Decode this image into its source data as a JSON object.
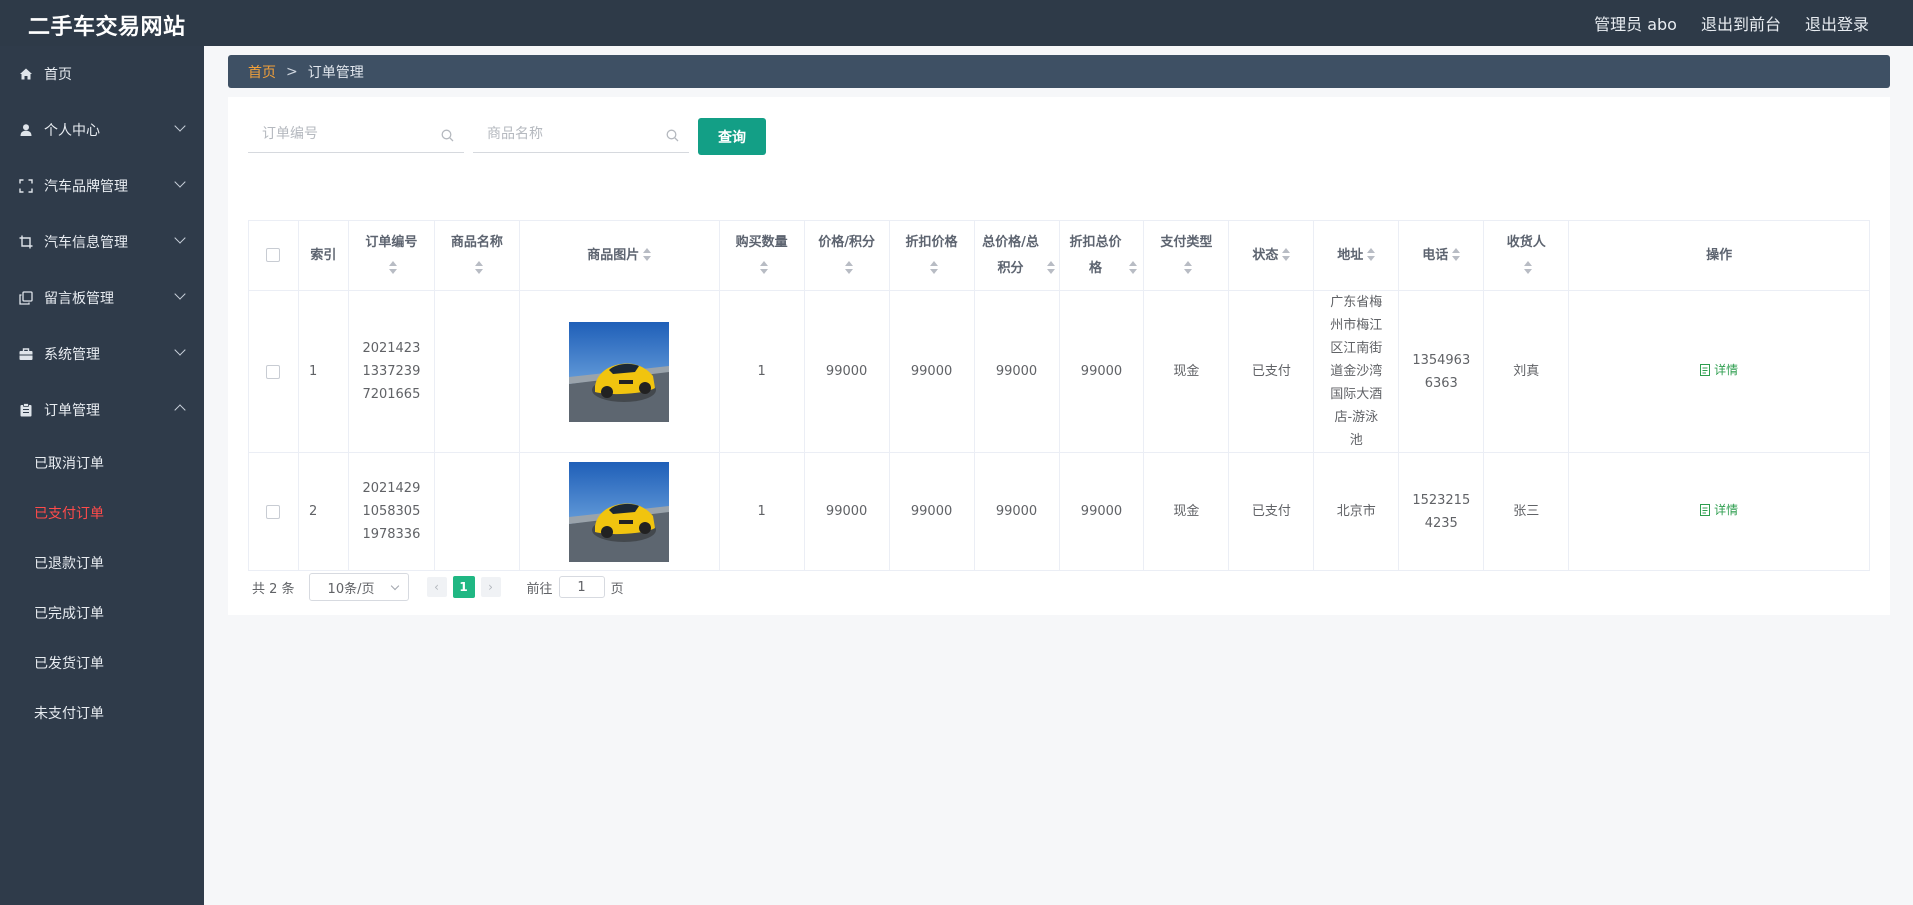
{
  "header": {
    "title": "二手车交易网站",
    "links": [
      "管理员 abo",
      "退出到前台",
      "退出登录"
    ]
  },
  "sidebar": {
    "items": [
      {
        "label": "首页",
        "icon": "home-icon",
        "expandable": false
      },
      {
        "label": "个人中心",
        "icon": "user-icon",
        "expandable": true
      },
      {
        "label": "汽车品牌管理",
        "icon": "fullscreen-icon",
        "expandable": true
      },
      {
        "label": "汽车信息管理",
        "icon": "crop-icon",
        "expandable": true
      },
      {
        "label": "留言板管理",
        "icon": "copy-icon",
        "expandable": true
      },
      {
        "label": "系统管理",
        "icon": "briefcase-icon",
        "expandable": true
      },
      {
        "label": "订单管理",
        "icon": "clipboard-icon",
        "expandable": true,
        "expanded": true
      }
    ],
    "submenu": [
      "已取消订单",
      "已支付订单",
      "已退款订单",
      "已完成订单",
      "已发货订单",
      "未支付订单"
    ],
    "active_submenu": "已支付订单"
  },
  "breadcrumb": {
    "home": "首页",
    "separator": ">",
    "current": "订单管理"
  },
  "search": {
    "order_placeholder": "订单编号",
    "product_placeholder": "商品名称",
    "button": "查询"
  },
  "table": {
    "headers": [
      "索引",
      "订单编号",
      "商品名称",
      "商品图片",
      "购买数量",
      "价格/积分",
      "折扣价格",
      "总价格/总积分",
      "折扣总价格",
      "支付类型",
      "状态",
      "地址",
      "电话",
      "收货人",
      "操作"
    ],
    "rows": [
      {
        "index": "1",
        "order_no": "202142313372397201665",
        "product_name": "",
        "quantity": "1",
        "price": "99000",
        "discount_price": "99000",
        "total": "99000",
        "discount_total": "99000",
        "pay_type": "现金",
        "status": "已支付",
        "address": "广东省梅州市梅江区江南街道金沙湾国际大酒店-游泳池",
        "phone": "13549636363",
        "receiver": "刘真",
        "action": "详情"
      },
      {
        "index": "2",
        "order_no": "202142910583051978336",
        "product_name": "",
        "quantity": "1",
        "price": "99000",
        "discount_price": "99000",
        "total": "99000",
        "discount_total": "99000",
        "pay_type": "现金",
        "status": "已支付",
        "address": "北京市",
        "phone": "15232154235",
        "receiver": "张三",
        "action": "详情"
      }
    ]
  },
  "pagination": {
    "total_text": "共 2 条",
    "page_size": "10条/页",
    "current_page": "1",
    "goto_prefix": "前往",
    "goto_value": "1",
    "goto_suffix": "页"
  },
  "colors": {
    "topbar": "#2e3a48",
    "sidebar": "#2f3b4a",
    "breadcrumb": "#3e5064",
    "accent": "#139f86",
    "active_menu": "#ff4b4b",
    "page_active": "#20b783"
  }
}
